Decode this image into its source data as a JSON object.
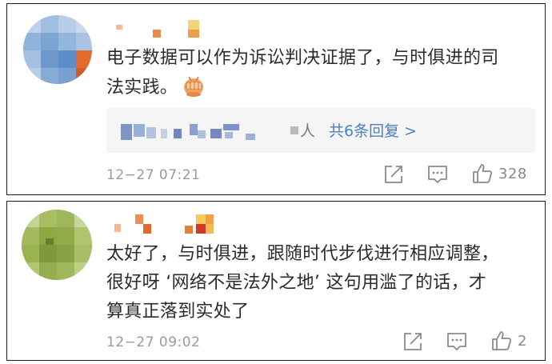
{
  "comments": [
    {
      "text_line1": "电子数据可以作为诉讼判决证据了，与时俱进的司",
      "text_line2": "法实践。",
      "emoji": "fist-emoji",
      "replies": {
        "person_label": "人",
        "summary": "共6条回复 >"
      },
      "timestamp": "12−27 07:21",
      "like_count": "328"
    },
    {
      "text_line1": "太好了，与时俱进，跟随时代步伐进行相应调整，",
      "text_line2": "很好呀 ‘网络不是法外之地’ 这句用滥了的话，才",
      "text_line3": "算真正落到实处了",
      "timestamp": "12−27 09:02",
      "like_count": "2"
    }
  ],
  "icons": [
    "share-icon",
    "comment-icon",
    "like-icon"
  ],
  "colors": {
    "text": "#2b2b2b",
    "meta": "#9a9a9a",
    "link": "#4b7fc4",
    "border": "#1e1e1e"
  }
}
